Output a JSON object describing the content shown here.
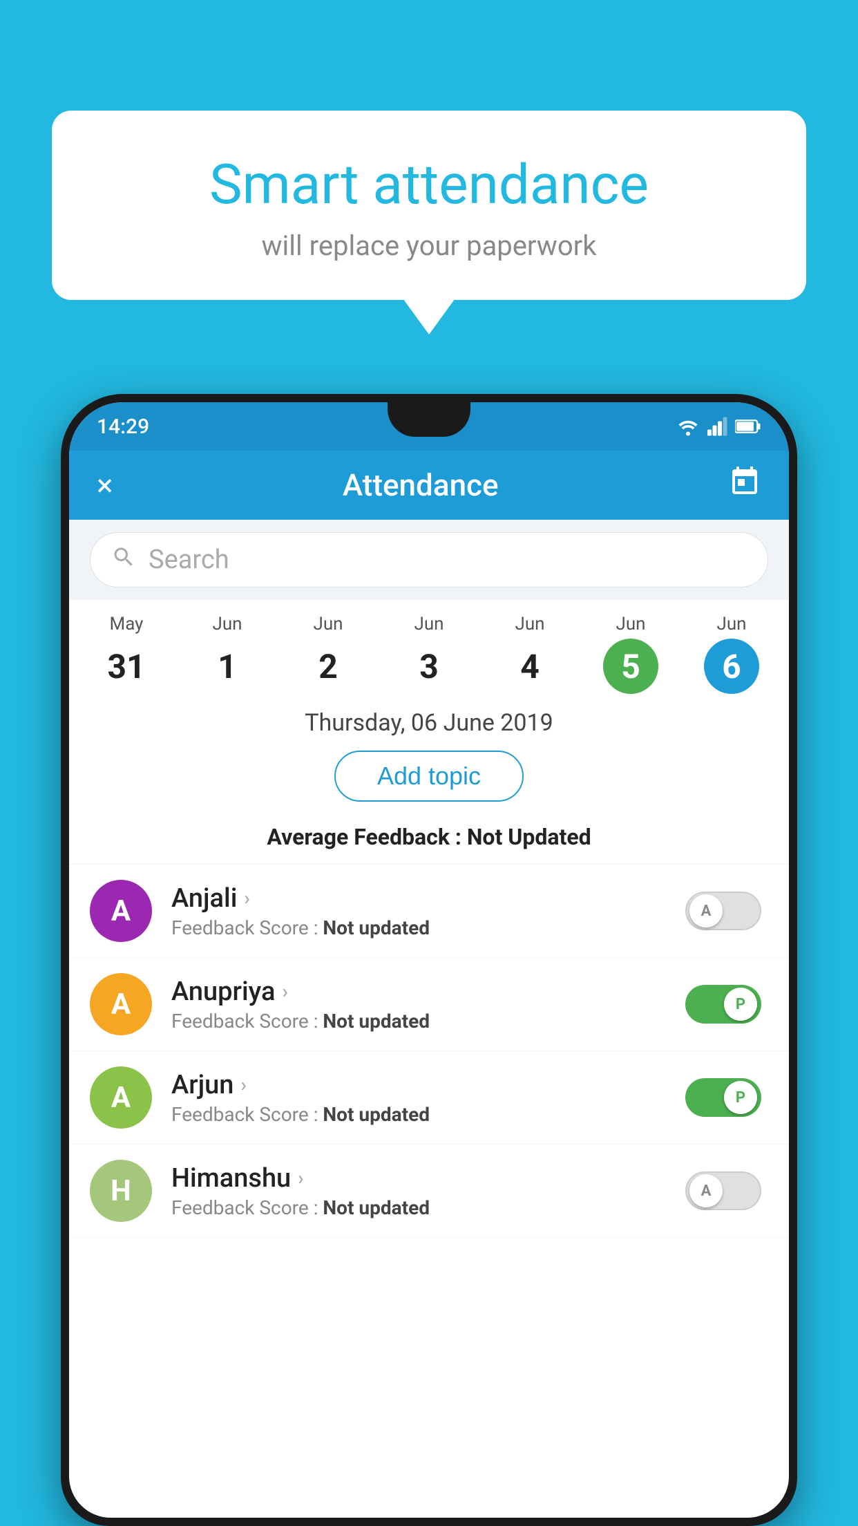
{
  "background_color": "#22b8e0",
  "bubble": {
    "title": "Smart attendance",
    "subtitle": "will replace your paperwork"
  },
  "status_bar": {
    "time": "14:29",
    "wifi_icon": "wifi",
    "signal_icon": "signal",
    "battery_icon": "battery"
  },
  "app_bar": {
    "title": "Attendance",
    "close_icon": "×",
    "calendar_icon": "📅"
  },
  "search": {
    "placeholder": "Search"
  },
  "calendar": {
    "days": [
      {
        "month": "May",
        "date": "31",
        "style": "normal"
      },
      {
        "month": "Jun",
        "date": "1",
        "style": "normal"
      },
      {
        "month": "Jun",
        "date": "2",
        "style": "normal"
      },
      {
        "month": "Jun",
        "date": "3",
        "style": "normal"
      },
      {
        "month": "Jun",
        "date": "4",
        "style": "normal"
      },
      {
        "month": "Jun",
        "date": "5",
        "style": "green"
      },
      {
        "month": "Jun",
        "date": "6",
        "style": "blue"
      }
    ]
  },
  "date_label": "Thursday, 06 June 2019",
  "add_topic_label": "Add topic",
  "avg_feedback_prefix": "Average Feedback : ",
  "avg_feedback_value": "Not Updated",
  "students": [
    {
      "name": "Anjali",
      "avatar_letter": "A",
      "avatar_color": "#9c27b0",
      "feedback": "Feedback Score : ",
      "feedback_value": "Not updated",
      "toggle": "off",
      "toggle_letter": "A"
    },
    {
      "name": "Anupriya",
      "avatar_letter": "A",
      "avatar_color": "#f5a623",
      "feedback": "Feedback Score : ",
      "feedback_value": "Not updated",
      "toggle": "on",
      "toggle_letter": "P"
    },
    {
      "name": "Arjun",
      "avatar_letter": "A",
      "avatar_color": "#8bc34a",
      "feedback": "Feedback Score : ",
      "feedback_value": "Not updated",
      "toggle": "on",
      "toggle_letter": "P"
    },
    {
      "name": "Himanshu",
      "avatar_letter": "H",
      "avatar_color": "#a5c77b",
      "feedback": "Feedback Score : ",
      "feedback_value": "Not updated",
      "toggle": "off",
      "toggle_letter": "A"
    }
  ]
}
